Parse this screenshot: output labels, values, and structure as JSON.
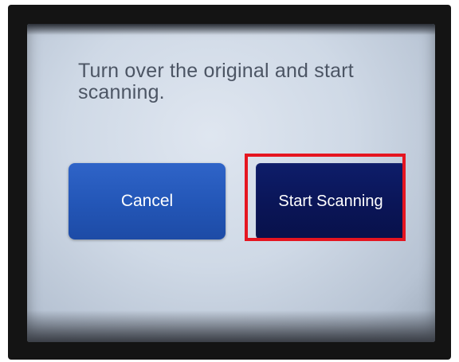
{
  "dialog": {
    "message": "Turn over the original and start scanning."
  },
  "buttons": {
    "cancel_label": "Cancel",
    "start_label": "Start Scanning"
  },
  "colors": {
    "cancel_button": "#2457b8",
    "start_button": "#0a1557",
    "highlight_border": "#e51520",
    "screen_background": "#cfd9e6",
    "message_text": "#4c5564"
  }
}
